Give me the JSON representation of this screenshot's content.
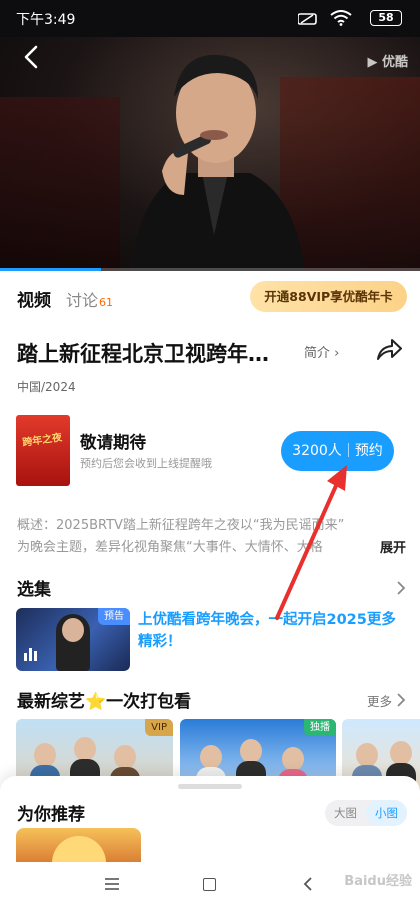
{
  "status_bar": {
    "time": "下午3:49",
    "battery": "58"
  },
  "player": {
    "brand": "优酷",
    "progress_fraction": 0.24
  },
  "tabs": {
    "video": "视频",
    "discuss": "讨论",
    "discuss_count": "61"
  },
  "vip_button": "开通88VIP享优酷年卡",
  "show": {
    "title": "踏上新征程北京卫视跨年…",
    "intro_link": "简介",
    "meta": "中国/2024"
  },
  "reserve_card": {
    "poster_text": "跨年之夜",
    "name": "敬请期待",
    "hint": "预约后您会收到上线提醒哦",
    "count": "3200人",
    "action": "预约"
  },
  "summary": {
    "line1": "概述：2025BRTV踏上新征程跨年之夜以“我为民谣而来”",
    "line2": "为晚会主题，差异化视角聚焦“大事件、大情怀、大格",
    "expand": "展开"
  },
  "episodes": {
    "section_title": "选集",
    "tag": "预告",
    "text": "上优酷看跨年晚会，一起开启2025更多精彩！"
  },
  "variety": {
    "section_title": "最新综艺⭐一次打包看",
    "more": "更多",
    "items": [
      {
        "badge": "VIP"
      },
      {
        "badge": "独播"
      },
      {
        "badge": ""
      }
    ]
  },
  "recommend": {
    "title": "为你推荐",
    "view_large": "大图",
    "view_small": "小图"
  },
  "watermark": "Baidu经验",
  "colors": {
    "accent": "#199dff",
    "vip_gold": "#fcd287",
    "annotation_red": "#e8302e"
  }
}
